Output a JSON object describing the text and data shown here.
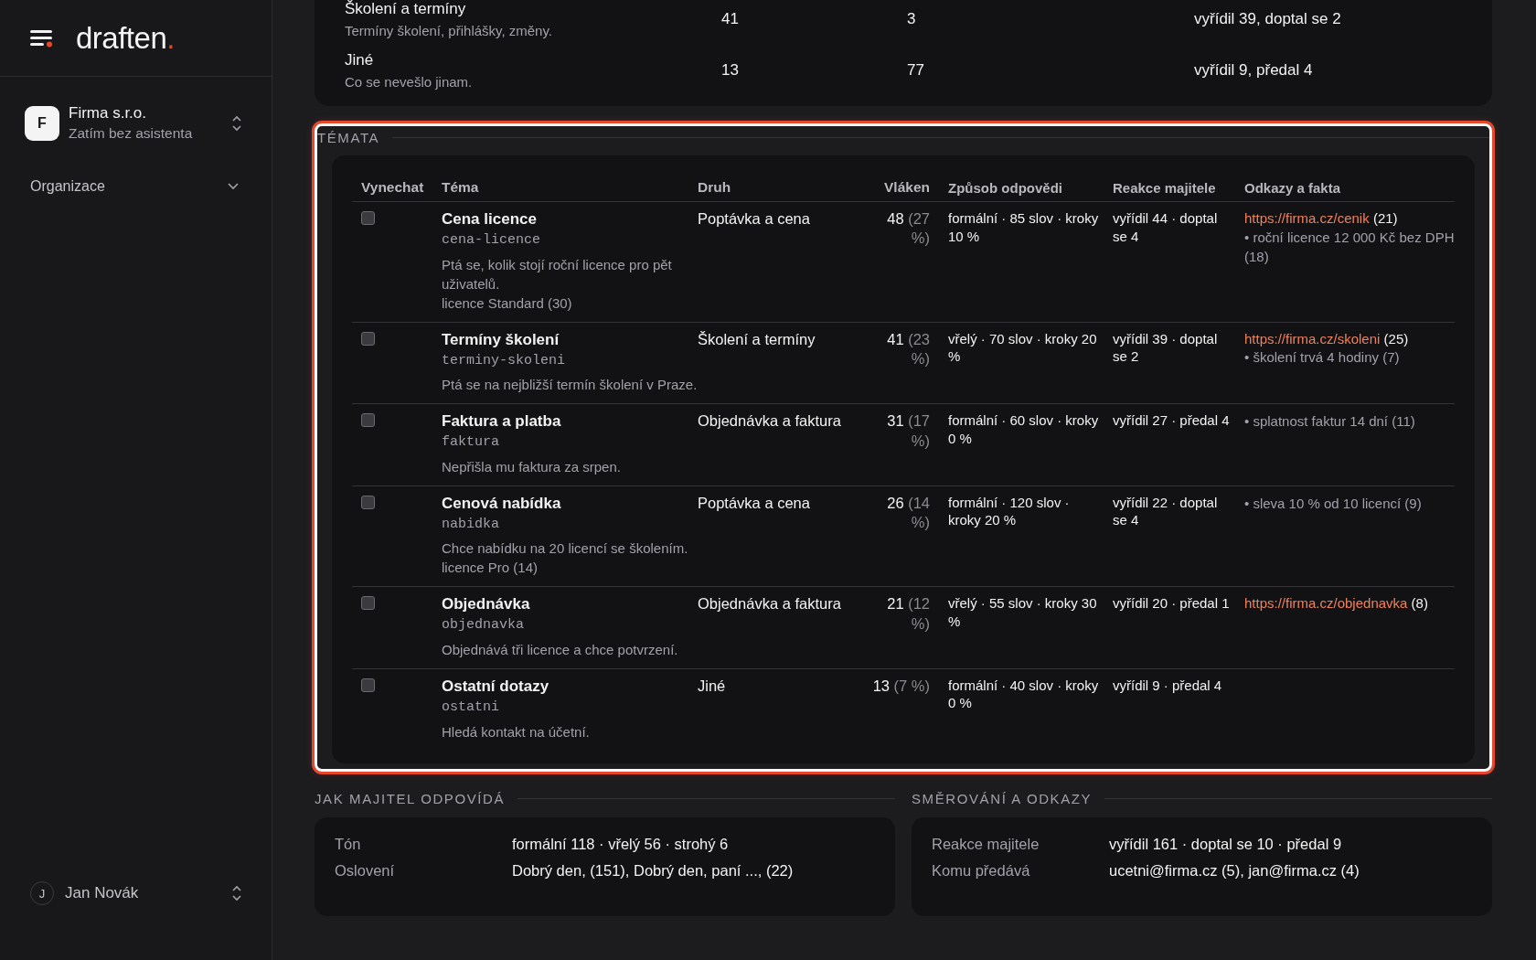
{
  "sidebar": {
    "logo": {
      "name": "draften",
      "dot": "."
    },
    "organization": {
      "initial": "F",
      "name": "Firma s.r.o.",
      "subtitle": "Zatím bez asistenta"
    },
    "nav": [
      {
        "label": "Organizace",
        "expanded": false
      }
    ],
    "user": {
      "initial": "J",
      "name": "Jan Novák"
    }
  },
  "categories": [
    {
      "name": "Školení a termíny",
      "description": "Termíny školení, přihlášky, změny.",
      "column_2": "41",
      "column_3": "3",
      "column_4": "vyřídil 39, doptal se 2"
    },
    {
      "name": "Jiné",
      "description": "Co se nevešlo jinam.",
      "column_2": "13",
      "column_3": "77",
      "column_4": "vyřídil 9, předal 4"
    }
  ],
  "topics": {
    "title": "TÉMATA",
    "highlighted": true,
    "columns": [
      "Vynechat",
      "Téma",
      "Druh",
      "Vláken",
      "Způsob odpovědi",
      "Reakce majitele",
      "Odkazy a fakta"
    ],
    "rows": [
      {
        "skip": false,
        "title": "Cena licence",
        "slug": "cena-licence",
        "description": "Ptá se, kolik stojí roční licence pro pět uživatelů.",
        "product": "licence Standard (30)",
        "kind": "Poptávka a cena",
        "threads": "48",
        "share": "(27 %)",
        "style": "formální · 85 slov · kroky 10 %",
        "reaction": "vyřídil 44 · doptal se 4",
        "links": [
          {
            "url": "https://firma.cz/cenik",
            "count": "(21)"
          }
        ],
        "facts": [
          "• roční licence 12 000 Kč bez DPH (18)"
        ]
      },
      {
        "skip": false,
        "title": "Termíny školení",
        "slug": "terminy-skoleni",
        "description": "Ptá se na nejbližší termín školení v Praze.",
        "kind": "Školení a termíny",
        "threads": "41",
        "share": "(23 %)",
        "style": "vřelý · 70 slov · kroky 20 %",
        "reaction": "vyřídil 39 · doptal se 2",
        "links": [
          {
            "url": "https://firma.cz/skoleni",
            "count": "(25)"
          }
        ],
        "facts": [
          "• školení trvá 4 hodiny (7)"
        ]
      },
      {
        "skip": false,
        "title": "Faktura a platba",
        "slug": "faktura",
        "description": "Nepřišla mu faktura za srpen.",
        "kind": "Objednávka a faktura",
        "threads": "31",
        "share": "(17 %)",
        "style": "formální · 60 slov · kroky 0 %",
        "reaction": "vyřídil 27 · předal 4",
        "facts": [
          "• splatnost faktur 14 dní (11)"
        ]
      },
      {
        "skip": false,
        "title": "Cenová nabídka",
        "slug": "nabidka",
        "description": "Chce nabídku na 20 licencí se školením.",
        "product": "licence Pro (14)",
        "kind": "Poptávka a cena",
        "threads": "26",
        "share": "(14 %)",
        "style": "formální · 120 slov · kroky 20 %",
        "reaction": "vyřídil 22 · doptal se 4",
        "facts": [
          "• sleva 10 % od 10 licencí (9)"
        ]
      },
      {
        "skip": false,
        "title": "Objednávka",
        "slug": "objednavka",
        "description": "Objednává tři licence a chce potvrzení.",
        "kind": "Objednávka a faktura",
        "threads": "21",
        "share": "(12 %)",
        "style": "vřelý · 55 slov · kroky 30 %",
        "reaction": "vyřídil 20 · předal 1",
        "links": [
          {
            "url": "https://firma.cz/objednavka",
            "count": "(8)"
          }
        ]
      },
      {
        "skip": false,
        "title": "Ostatní dotazy",
        "slug": "ostatni",
        "description": "Hledá kontakt na účetní.",
        "kind": "Jiné",
        "threads": "13",
        "share": "(7 %)",
        "style": "formální · 40 slov · kroky 0 %",
        "reaction": "vyřídil 9 · předal 4"
      }
    ]
  },
  "summaries": [
    {
      "title": "JAK MAJITEL ODPOVÍDÁ",
      "rows": [
        {
          "label": "Tón",
          "value": "formální 118 · vřelý 56 · strohý 6"
        },
        {
          "label": "Oslovení",
          "value": "Dobrý den, (151), Dobrý den, paní ..., (22)"
        }
      ]
    },
    {
      "title": "SMĚROVÁNÍ A ODKAZY",
      "rows": [
        {
          "label": "Reakce majitele",
          "value": "vyřídil 161 · doptal se 10 · předal 9"
        },
        {
          "label": "Komu předává",
          "value": "ucetni@firma.cz (5), jan@firma.cz (4)"
        }
      ]
    }
  ]
}
